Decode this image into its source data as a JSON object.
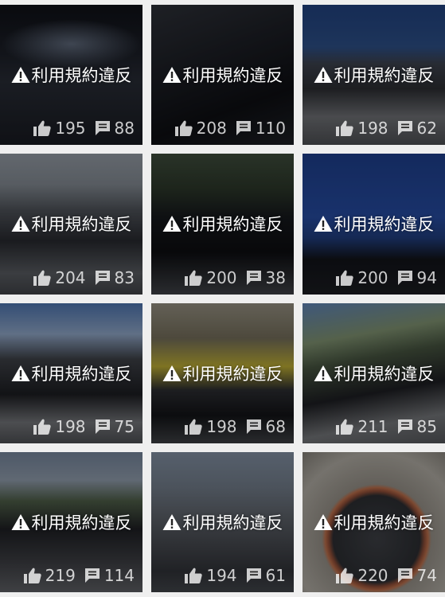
{
  "warning_text": "利用規約違反",
  "icons": {
    "warning": "warning-triangle-icon",
    "like": "thumbs-up-icon",
    "comment": "comment-icon"
  },
  "colors": {
    "background": "#efefef",
    "overlay_text": "#ffffff",
    "stats_text": "#c7c7c7"
  },
  "posts": [
    {
      "likes": "195",
      "comments": "88"
    },
    {
      "likes": "208",
      "comments": "110"
    },
    {
      "likes": "198",
      "comments": "62"
    },
    {
      "likes": "204",
      "comments": "83"
    },
    {
      "likes": "200",
      "comments": "38"
    },
    {
      "likes": "200",
      "comments": "94"
    },
    {
      "likes": "198",
      "comments": "75"
    },
    {
      "likes": "198",
      "comments": "68"
    },
    {
      "likes": "211",
      "comments": "85"
    },
    {
      "likes": "219",
      "comments": "114"
    },
    {
      "likes": "194",
      "comments": "61"
    },
    {
      "likes": "220",
      "comments": "74"
    }
  ]
}
